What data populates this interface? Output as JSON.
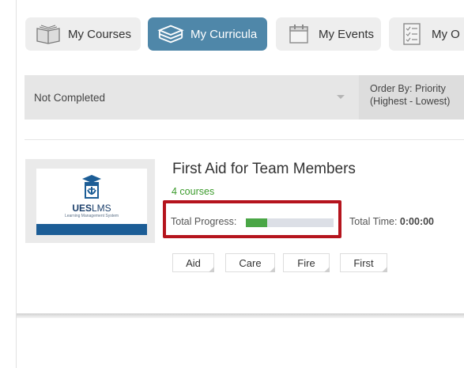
{
  "tabs": [
    {
      "label": "My Courses",
      "icon": "book-open-icon",
      "active": false
    },
    {
      "label": "My Curricula",
      "icon": "books-stack-icon",
      "active": true
    },
    {
      "label": "My Events",
      "icon": "calendar-icon",
      "active": false
    },
    {
      "label": "My O",
      "icon": "checklist-icon",
      "active": false
    }
  ],
  "filters": {
    "status_value": "Not Completed",
    "order_line1": "Order By: Priority",
    "order_line2": "(Highest - Lowest)"
  },
  "curriculum": {
    "title": "First Aid for Team Members",
    "count": "4 courses",
    "progress_label": "Total Progress:",
    "progress_fraction": 0.24,
    "total_time_label": "Total Time:",
    "total_time_value": "0:00:00",
    "thumbnail": {
      "logo_bold": "UES",
      "logo_light": "LMS",
      "tagline": "Learning Management System"
    }
  },
  "tags": [
    "Aid",
    "Care",
    "Fire",
    "First"
  ],
  "colors": {
    "accent_tab": "#4f87a9",
    "progress_fill": "#4aa646",
    "count_green": "#3b9b2c",
    "highlight_red": "#b5141d"
  }
}
